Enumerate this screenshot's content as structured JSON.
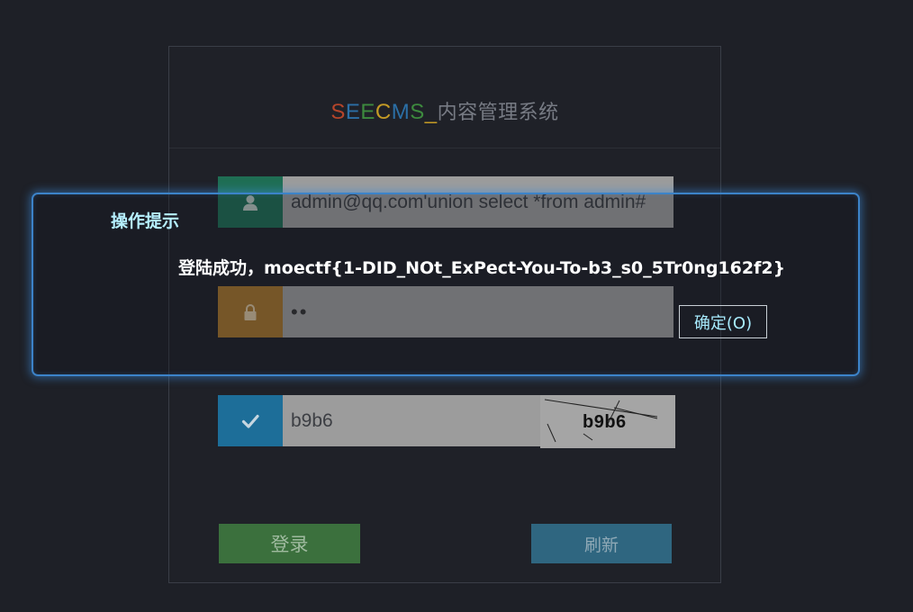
{
  "logo": {
    "parts": [
      {
        "text": "S",
        "color": "#b5452a"
      },
      {
        "text": "E",
        "color": "#2b6fa6"
      },
      {
        "text": "E",
        "color": "#3d8a3e"
      },
      {
        "text": "C",
        "color": "#c39a25"
      },
      {
        "text": "M",
        "color": "#2b6fa6"
      },
      {
        "text": "S",
        "color": "#3d8a3e"
      },
      {
        "text": "_",
        "color": "#c39a25"
      }
    ],
    "suffix": "内容管理系统"
  },
  "form": {
    "username": "admin@qq.com'union select *from admin#",
    "password": "••",
    "captcha_input": "b9b6",
    "captcha_image_text": "b9b6",
    "user_icon": "user-icon",
    "lock_icon": "lock-icon",
    "check_icon": "check-icon"
  },
  "buttons": {
    "login": "登录",
    "refresh": "刷新"
  },
  "dialog": {
    "title": "操作提示",
    "message": "登陆成功，moectf{1-DID_NOt_ExPect-You-To-b3_s0_5Tr0ng162f2}",
    "ok": "确定(O)"
  },
  "colors": {
    "background": "#1e2027",
    "dialog_border": "#3c83c9",
    "login_button": "#3b703d",
    "refresh_button": "#2f6680"
  }
}
